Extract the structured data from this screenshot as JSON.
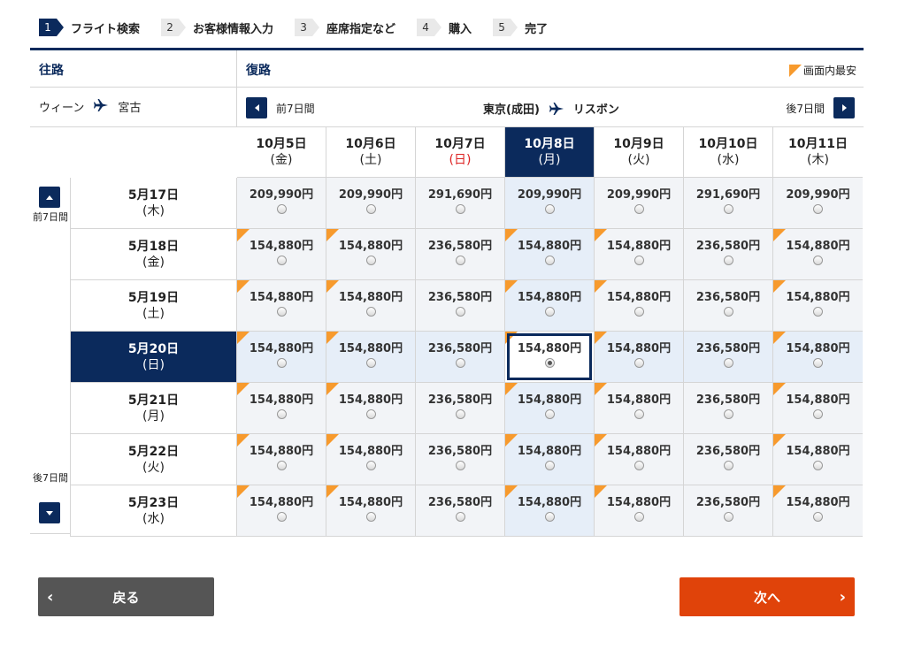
{
  "steps": [
    {
      "num": "1",
      "label": "フライト検索",
      "active": true
    },
    {
      "num": "2",
      "label": "お客様情報入力",
      "active": false
    },
    {
      "num": "3",
      "label": "座席指定など",
      "active": false
    },
    {
      "num": "4",
      "label": "購入",
      "active": false
    },
    {
      "num": "5",
      "label": "完了",
      "active": false
    }
  ],
  "outbound": {
    "title": "往路",
    "from": "ウィーン",
    "to": "宮古"
  },
  "return": {
    "title": "復路",
    "legend": "画面内最安",
    "prev_label": "前7日間",
    "next_label": "後7日間",
    "from": "東京(成田)",
    "to": "リスボン"
  },
  "side": {
    "prev_label": "前7日間",
    "next_label": "後7日間"
  },
  "columns": [
    {
      "date": "10月5日",
      "weekday": "(金)"
    },
    {
      "date": "10月6日",
      "weekday": "(土)"
    },
    {
      "date": "10月7日",
      "weekday": "(日)"
    },
    {
      "date": "10月8日",
      "weekday": "(月)"
    },
    {
      "date": "10月9日",
      "weekday": "(火)"
    },
    {
      "date": "10月10日",
      "weekday": "(水)"
    },
    {
      "date": "10月11日",
      "weekday": "(木)"
    }
  ],
  "selected_column": 3,
  "selected_row": 3,
  "rows": [
    {
      "date": "5月17日",
      "weekday": "(木)",
      "prices": [
        "209,990円",
        "209,990円",
        "291,690円",
        "209,990円",
        "209,990円",
        "291,690円",
        "209,990円"
      ],
      "cheapest": [
        false,
        false,
        false,
        false,
        false,
        false,
        false
      ]
    },
    {
      "date": "5月18日",
      "weekday": "(金)",
      "prices": [
        "154,880円",
        "154,880円",
        "236,580円",
        "154,880円",
        "154,880円",
        "236,580円",
        "154,880円"
      ],
      "cheapest": [
        true,
        true,
        false,
        true,
        true,
        false,
        true
      ]
    },
    {
      "date": "5月19日",
      "weekday": "(土)",
      "prices": [
        "154,880円",
        "154,880円",
        "236,580円",
        "154,880円",
        "154,880円",
        "236,580円",
        "154,880円"
      ],
      "cheapest": [
        true,
        true,
        false,
        true,
        true,
        false,
        true
      ]
    },
    {
      "date": "5月20日",
      "weekday": "(日)",
      "prices": [
        "154,880円",
        "154,880円",
        "236,580円",
        "154,880円",
        "154,880円",
        "236,580円",
        "154,880円"
      ],
      "cheapest": [
        true,
        true,
        false,
        true,
        true,
        false,
        true
      ]
    },
    {
      "date": "5月21日",
      "weekday": "(月)",
      "prices": [
        "154,880円",
        "154,880円",
        "236,580円",
        "154,880円",
        "154,880円",
        "236,580円",
        "154,880円"
      ],
      "cheapest": [
        true,
        true,
        false,
        true,
        true,
        false,
        true
      ]
    },
    {
      "date": "5月22日",
      "weekday": "(火)",
      "prices": [
        "154,880円",
        "154,880円",
        "236,580円",
        "154,880円",
        "154,880円",
        "236,580円",
        "154,880円"
      ],
      "cheapest": [
        true,
        true,
        false,
        true,
        true,
        false,
        true
      ]
    },
    {
      "date": "5月23日",
      "weekday": "(水)",
      "prices": [
        "154,880円",
        "154,880円",
        "236,580円",
        "154,880円",
        "154,880円",
        "236,580円",
        "154,880円"
      ],
      "cheapest": [
        true,
        true,
        false,
        true,
        true,
        false,
        true
      ]
    }
  ],
  "buttons": {
    "back": "戻る",
    "next": "次へ"
  },
  "colors": {
    "navy": "#0b2a5c",
    "cheapest_marker": "#f79a2d",
    "next_button": "#e0430a",
    "back_button": "#555555",
    "sunday": "#dd2222"
  }
}
